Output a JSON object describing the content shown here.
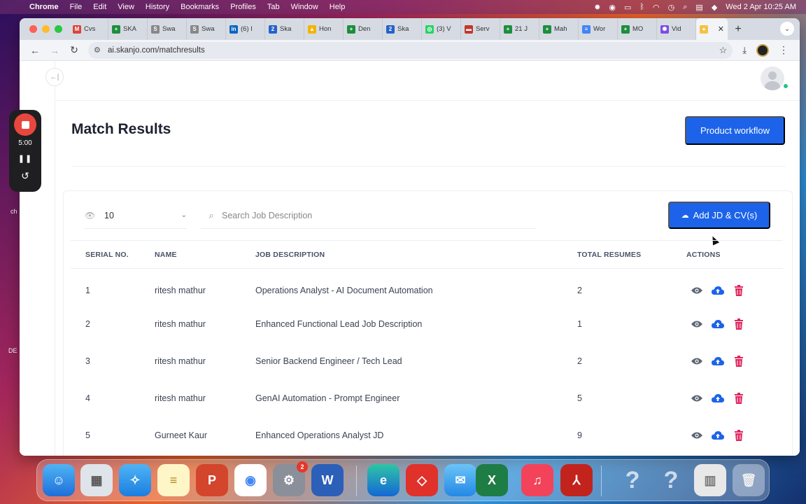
{
  "menubar": {
    "app": "Chrome",
    "items": [
      "File",
      "Edit",
      "View",
      "History",
      "Bookmarks",
      "Profiles",
      "Tab",
      "Window",
      "Help"
    ],
    "datetime": "Wed 2 Apr  10:25 AM"
  },
  "tabs": [
    {
      "label": "Cvs",
      "color": "#d9453a",
      "glyph": "M"
    },
    {
      "label": "SKA",
      "color": "#1e8e3e",
      "glyph": "+"
    },
    {
      "label": "Swa",
      "color": "#888888",
      "glyph": "S"
    },
    {
      "label": "Swa",
      "color": "#888888",
      "glyph": "S"
    },
    {
      "label": "(6) I",
      "color": "#0a66c2",
      "glyph": "in"
    },
    {
      "label": "Ska",
      "color": "#2563c9",
      "glyph": "2"
    },
    {
      "label": "Hon",
      "color": "#f4b400",
      "glyph": "▲"
    },
    {
      "label": "Den",
      "color": "#1e8e3e",
      "glyph": "+"
    },
    {
      "label": "Ska",
      "color": "#2563c9",
      "glyph": "2"
    },
    {
      "label": "(3) V",
      "color": "#25d366",
      "glyph": "◎"
    },
    {
      "label": "Serv",
      "color": "#c0392b",
      "glyph": "▬"
    },
    {
      "label": "21 J",
      "color": "#1e8e3e",
      "glyph": "+"
    },
    {
      "label": "Mah",
      "color": "#1e8e3e",
      "glyph": "+"
    },
    {
      "label": "Wor",
      "color": "#4285f4",
      "glyph": "≡"
    },
    {
      "label": "MO",
      "color": "#1e8e3e",
      "glyph": "+"
    },
    {
      "label": "Vid",
      "color": "#7b4fe0",
      "glyph": "✺"
    }
  ],
  "address": {
    "url": "ai.skanjo.com/matchresults"
  },
  "page": {
    "title": "Match Results",
    "workflow_button": "Product workflow",
    "page_size": "10",
    "search_placeholder": "Search Job Description",
    "add_button": "Add JD & CV(s)"
  },
  "table": {
    "headers": [
      "SERIAL NO.",
      "NAME",
      "JOB DESCRIPTION",
      "TOTAL RESUMES",
      "ACTIONS"
    ],
    "rows": [
      {
        "serial": "1",
        "name": "ritesh mathur",
        "jd": "Operations Analyst - AI Document Automation",
        "total": "2"
      },
      {
        "serial": "2",
        "name": "ritesh mathur",
        "jd": "Enhanced Functional Lead Job Description",
        "total": "1"
      },
      {
        "serial": "3",
        "name": "ritesh mathur",
        "jd": "Senior Backend Engineer / Tech Lead",
        "total": "2"
      },
      {
        "serial": "4",
        "name": "ritesh mathur",
        "jd": "GenAI Automation - Prompt Engineer",
        "total": "5"
      },
      {
        "serial": "5",
        "name": "Gurneet Kaur",
        "jd": "Enhanced Operations Analyst JD",
        "total": "9"
      }
    ]
  },
  "recorder": {
    "time": "5:00"
  },
  "desktop_labels": {
    "left_top": "ch",
    "left_bottom": "DE"
  },
  "dock": {
    "settings_badge": "2"
  },
  "colors": {
    "primary": "#1c63ea",
    "action_icon": "#5c6473",
    "upload_icon": "#1c63ea",
    "delete_icon": "#e0245e"
  }
}
